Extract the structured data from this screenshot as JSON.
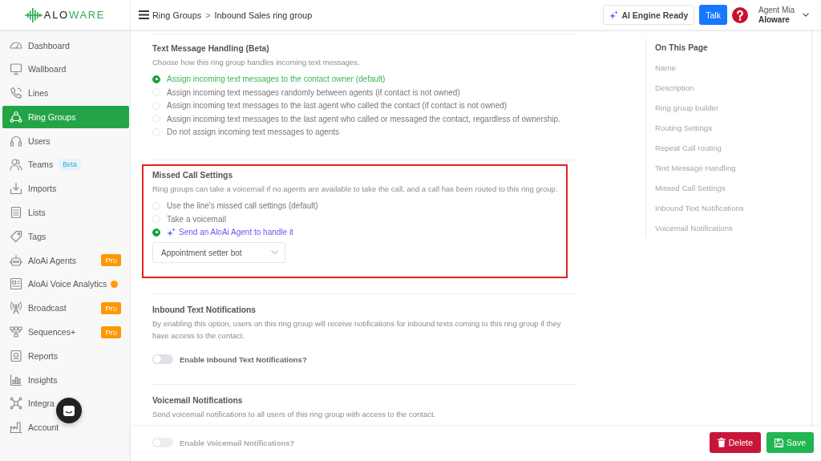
{
  "header": {
    "logo": {
      "parts": [
        {
          "text": "ALO",
          "kind": "plain"
        },
        {
          "text": "WARE",
          "kind": "accent"
        }
      ]
    },
    "breadcrumb": {
      "items": [
        "Ring Groups",
        "Inbound Sales ring group"
      ],
      "separator": ">"
    },
    "ai_status": {
      "label": "AI Engine Ready"
    },
    "talk_button": {
      "label": "Talk"
    },
    "user": {
      "name": "Agent Mia",
      "company": "Aloware"
    }
  },
  "sidebar": {
    "items": [
      {
        "label": "Dashboard",
        "selected": false
      },
      {
        "label": "Wallboard",
        "selected": false
      },
      {
        "label": "Lines",
        "selected": false
      },
      {
        "label": "Ring Groups",
        "selected": true
      },
      {
        "label": "Users",
        "selected": false
      },
      {
        "label": "Teams",
        "selected": false,
        "badge": {
          "text": "Beta",
          "kind": "beta"
        }
      },
      {
        "label": "Imports",
        "selected": false
      },
      {
        "label": "Lists",
        "selected": false
      },
      {
        "label": "Tags",
        "selected": false
      },
      {
        "label": "AloAi Agents",
        "selected": false,
        "badge": {
          "text": "Pro",
          "kind": "pro"
        }
      },
      {
        "label": "AloAi Voice Analytics",
        "selected": false,
        "dot": {
          "color": "#ff9d00"
        }
      },
      {
        "label": "Broadcast",
        "selected": false,
        "badge": {
          "text": "Pro",
          "kind": "pro"
        }
      },
      {
        "label": "Sequences+",
        "selected": false,
        "badge": {
          "text": "Pro",
          "kind": "pro"
        }
      },
      {
        "label": "Reports",
        "selected": false
      },
      {
        "label": "Insights",
        "selected": false
      },
      {
        "label": "Integra",
        "selected": false
      },
      {
        "label": "Account",
        "selected": false
      }
    ]
  },
  "sections": [
    {
      "title": "Text Message Handling (Beta)",
      "description": "Choose how this ring group handles incoming text messages.",
      "highlighted": false,
      "options": [
        {
          "label": "Assign incoming text messages to the contact owner (default)",
          "selected": true,
          "kind": "plain"
        },
        {
          "label": "Assign incoming text messages randomly between agents (if contact is not owned)",
          "selected": false,
          "kind": "plain"
        },
        {
          "label": "Assign incoming text messages to the last agent who called the contact (if contact is not owned)",
          "selected": false,
          "kind": "plain"
        },
        {
          "label": "Assign incoming text messages to the last agent who called or messaged the contact, regardless of ownership.",
          "selected": false,
          "kind": "plain"
        },
        {
          "label": "Do not assign incoming text messages to agents",
          "selected": false,
          "kind": "plain"
        }
      ]
    },
    {
      "title": "Missed Call Settings",
      "description": "Ring groups can take a voicemail if no agents are available to take the call, and a call has been routed to this ring group.",
      "highlighted": true,
      "options": [
        {
          "label": "Use the line's missed call settings (default)",
          "selected": false,
          "kind": "plain"
        },
        {
          "label": "Take a voicemail",
          "selected": false,
          "kind": "plain"
        },
        {
          "label": "Send an AloAi Agent to handle it",
          "selected": true,
          "kind": "ai"
        }
      ],
      "select": {
        "value": "Appointment setter bot"
      }
    },
    {
      "title": "Inbound Text Notifications",
      "description": "By enabling this option, users on this ring group will receive notifications for inbound texts coming to this ring group if they have access to the contact.",
      "highlighted": false,
      "toggle": {
        "label": "Enable Inbound Text Notifications?",
        "on": false,
        "obscured": false
      }
    },
    {
      "title": "Voicemail Notifications",
      "description": "Send voicemail notifications to all users of this ring group with access to the contact.",
      "highlighted": false,
      "toggle": {
        "label": "Enable Voicemail Notifications?",
        "on": false,
        "obscured": true
      }
    }
  ],
  "toc": {
    "title": "On This Page",
    "items": [
      "Name",
      "Description",
      "Ring group builder",
      "Routing Settings",
      "Repeat Call routing",
      "Text Message Handling",
      "Missed Call Settings",
      "Inbound Text Notifications",
      "Voicemail Notifications"
    ]
  },
  "footer": {
    "buttons": [
      {
        "label": "Delete",
        "kind": "danger"
      },
      {
        "label": "Save",
        "kind": "primary"
      }
    ]
  }
}
